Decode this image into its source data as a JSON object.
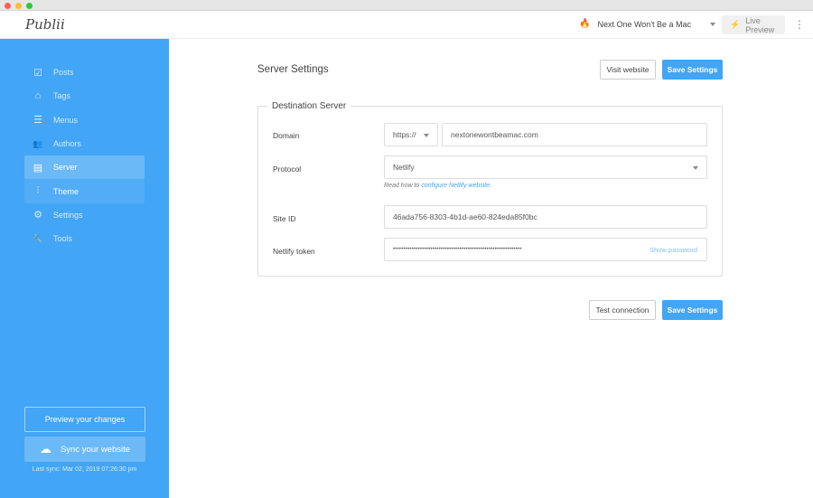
{
  "window": {
    "colors": {
      "close": "#fe5f57",
      "min": "#febc2e",
      "max": "#28c840"
    }
  },
  "topbar": {
    "logo": "Publii",
    "site_name": "Next One Won't Be a Mac",
    "live_preview": "Live Preview"
  },
  "sidebar": {
    "items": [
      {
        "label": "Posts",
        "icon": "posts-icon",
        "glyph": "☑"
      },
      {
        "label": "Tags",
        "icon": "tag-icon",
        "glyph": "⌂"
      },
      {
        "label": "Menus",
        "icon": "menu-icon",
        "glyph": "☰"
      },
      {
        "label": "Authors",
        "icon": "authors-icon",
        "glyph": "👥"
      },
      {
        "label": "Server",
        "icon": "server-icon",
        "glyph": "▤"
      },
      {
        "label": "Theme",
        "icon": "sliders-icon",
        "glyph": "⫶"
      },
      {
        "label": "Settings",
        "icon": "gear-icon",
        "glyph": "⚙"
      },
      {
        "label": "Tools",
        "icon": "wrench-icon",
        "glyph": "🔧"
      }
    ],
    "preview_button": "Preview your changes",
    "sync_button": "Sync your website",
    "last_sync": "Last sync: Mar 02, 2019 07:26:30 pm",
    "accent": "#42a5f5"
  },
  "main": {
    "title": "Server Settings",
    "visit_website": "Visit website",
    "save_settings": "Save Settings",
    "test_connection": "Test connection",
    "fieldset_title": "Destination Server",
    "domain_label": "Domain",
    "protocol_prefix": "https://",
    "domain_value": "nextonewontbeamac.com",
    "protocol_label": "Protocol",
    "protocol_value": "Netlify",
    "hint_prefix": "Read how to ",
    "hint_link": "configure Netlify website",
    "hint_suffix": ".",
    "site_id_label": "Site ID",
    "site_id_value": "46ada756-8303-4b1d-ae60-824eda85f0bc",
    "token_label": "Netlify token",
    "token_value": "••••••••••••••••••••••••••••••••••••••••••••••••••••••••••••••",
    "show_password": "Show password"
  }
}
